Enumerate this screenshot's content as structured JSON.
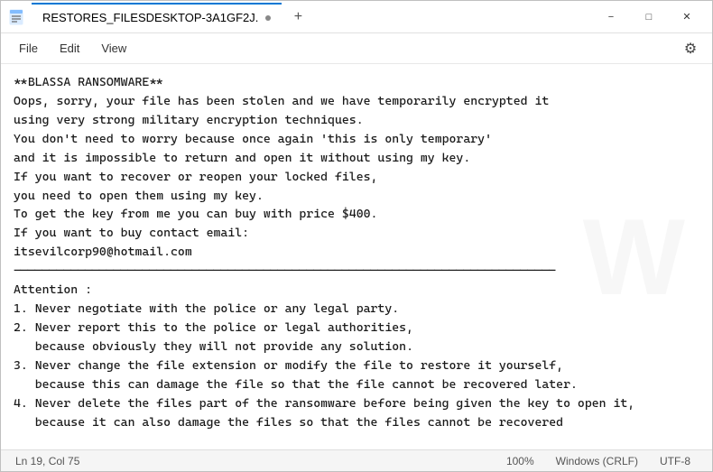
{
  "titleBar": {
    "icon": "📄",
    "tabTitle": "RESTORES_FILESDESKTOP-3A1GF2J.",
    "newTabLabel": "+",
    "minimizeLabel": "−",
    "maximizeLabel": "□",
    "closeLabel": "✕"
  },
  "menuBar": {
    "items": [
      "File",
      "Edit",
      "View"
    ],
    "gearIcon": "⚙"
  },
  "editor": {
    "content": "**BLASSA RANSOMWARE**\nOops, sorry, your file has been stolen and we have temporarily encrypted it\nusing very strong military encryption techniques.\nYou don't need to worry because once again 'this is only temporary'\nand it is impossible to return and open it without using my key.\nIf you want to recover or reopen your locked files,\nyou need to open them using my key.\nTo get the key from me you can buy with price $400.\nIf you want to buy contact email:\nitsevilcorp90@hotmail.com\n----------------------------------------------------------------------------\nAttention :\n1. Never negotiate with the police or any legal party.\n2. Never report this to the police or legal authorities,\n   because obviously they will not provide any solution.\n3. Never change the file extension or modify the file to restore it yourself,\n   because this can damage the file so that the file cannot be recovered later.\n4. Never delete the files part of the ransomware before being given the key to open it,\n   because it can also damage the files so that the files cannot be recovered"
  },
  "statusBar": {
    "lineCol": "Ln 19, Col 75",
    "zoom": "100%",
    "lineEnding": "Windows (CRLF)",
    "encoding": "UTF-8"
  }
}
